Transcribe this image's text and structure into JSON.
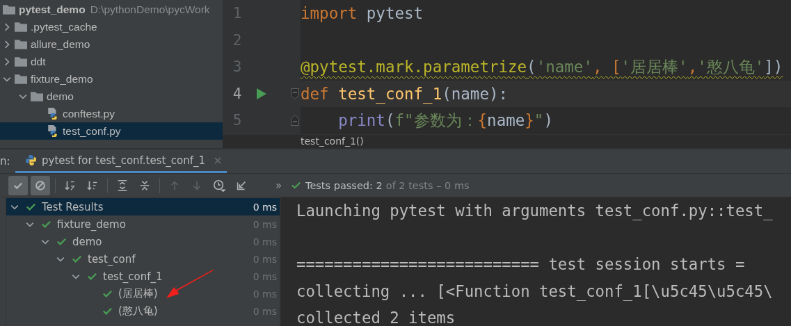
{
  "project": {
    "name": "pytest_demo",
    "path": "D:\\pythonDemo\\pycWork",
    "items": [
      {
        "label": ".pytest_cache",
        "kind": "folder",
        "expanded": false,
        "selected": false
      },
      {
        "label": "allure_demo",
        "kind": "folder",
        "expanded": false,
        "selected": false
      },
      {
        "label": "ddt",
        "kind": "folder",
        "expanded": false,
        "selected": false
      },
      {
        "label": "fixture_demo",
        "kind": "folder",
        "expanded": true,
        "selected": false,
        "children": [
          {
            "label": "demo",
            "kind": "folder",
            "expanded": true,
            "selected": false,
            "children": [
              {
                "label": "conftest.py",
                "kind": "python",
                "selected": false
              },
              {
                "label": "test_conf.py",
                "kind": "python",
                "selected": true
              }
            ]
          }
        ]
      }
    ]
  },
  "editor": {
    "lines": [
      {
        "number": "1",
        "current": false,
        "warning": false,
        "tokens": [
          {
            "text": "import",
            "kind": "keyword"
          },
          {
            "text": " pytest",
            "kind": "plain"
          }
        ]
      },
      {
        "number": "2",
        "current": false
      },
      {
        "number": "3",
        "current": false,
        "warning": true,
        "tokens": [
          {
            "text": "@pytest.mark.parametrize",
            "kind": "decorator"
          },
          {
            "text": "(",
            "kind": "plain"
          },
          {
            "text": "'name'",
            "kind": "string"
          },
          {
            "text": ", [",
            "kind": "keyword"
          },
          {
            "text": "'居居棒'",
            "kind": "string"
          },
          {
            "text": ",",
            "kind": "keyword"
          },
          {
            "text": "'憨八龟'",
            "kind": "string"
          },
          {
            "text": "])",
            "kind": "plain"
          }
        ]
      },
      {
        "number": "4",
        "run": true,
        "fold_open": true,
        "current": true,
        "warning": false,
        "tokens": [
          {
            "text": "def ",
            "kind": "keyword"
          },
          {
            "text": "test_conf_1",
            "kind": "function"
          },
          {
            "text": "(name):",
            "kind": "plain"
          }
        ]
      },
      {
        "number": "5",
        "fold_close": true,
        "current": false,
        "warning": false,
        "tokens": [
          {
            "text": "    print",
            "kind": "builtin"
          },
          {
            "text": "(",
            "kind": "plain"
          },
          {
            "text": "f\"参数为：",
            "kind": "string"
          },
          {
            "text": "{",
            "kind": "keyword"
          },
          {
            "text": "name",
            "kind": "plain"
          },
          {
            "text": "}",
            "kind": "keyword"
          },
          {
            "text": "\"",
            "kind": "string"
          },
          {
            "text": ")",
            "kind": "plain"
          }
        ]
      }
    ],
    "breadcrumb": "test_conf_1()"
  },
  "run_panel": {
    "label": "n:",
    "tab": {
      "title": "pytest for test_conf.test_conf_1",
      "selected": true
    },
    "toolbar": [
      {
        "kind": "passed",
        "selected": true,
        "disabled": false
      },
      {
        "kind": "ignored",
        "selected": true,
        "disabled": false
      },
      {
        "kind": "sort-alpha",
        "selected": false,
        "disabled": false
      },
      {
        "kind": "sort-duration",
        "selected": false,
        "disabled": false
      },
      {
        "kind": "expand-all",
        "selected": false,
        "disabled": false
      },
      {
        "kind": "collapse-all",
        "selected": false,
        "disabled": false
      },
      {
        "kind": "previous",
        "selected": false,
        "disabled": true
      },
      {
        "kind": "next",
        "selected": false,
        "disabled": true
      },
      {
        "kind": "history",
        "selected": false,
        "disabled": false
      },
      {
        "kind": "import",
        "selected": false,
        "disabled": false
      }
    ],
    "more": "»",
    "status": {
      "passed": true,
      "label": "Tests passed: 2",
      "detail": "of 2 tests – 0 ms"
    },
    "results": [
      {
        "label": "Test Results",
        "time": "0 ms",
        "passed": true,
        "expanded": true,
        "selected": true,
        "children": [
          {
            "label": "fixture_demo",
            "time": "0 ms",
            "passed": true,
            "expanded": true,
            "selected": false,
            "children": [
              {
                "label": "demo",
                "time": "0 ms",
                "passed": true,
                "expanded": true,
                "selected": false,
                "children": [
                  {
                    "label": "test_conf",
                    "time": "0 ms",
                    "passed": true,
                    "expanded": true,
                    "selected": false,
                    "children": [
                      {
                        "label": "test_conf_1",
                        "time": "0 ms",
                        "passed": true,
                        "expanded": true,
                        "selected": false,
                        "children": [
                          {
                            "label": "(居居棒)",
                            "time": "0 ms",
                            "passed": true,
                            "selected": false
                          },
                          {
                            "label": "(憨八龟)",
                            "time": "0 ms",
                            "passed": true,
                            "selected": false
                          }
                        ]
                      }
                    ]
                  }
                ]
              }
            ]
          }
        ]
      }
    ],
    "console": [
      {
        "text": "Launching pytest with arguments test_conf.py::test_"
      },
      {
        "text": "========================== test session starts =",
        "blank_before": true
      },
      {
        "text": "collecting ... [<Function test_conf_1[\\u5c45\\u5c45\\"
      },
      {
        "text": "collected 2 items"
      }
    ]
  }
}
